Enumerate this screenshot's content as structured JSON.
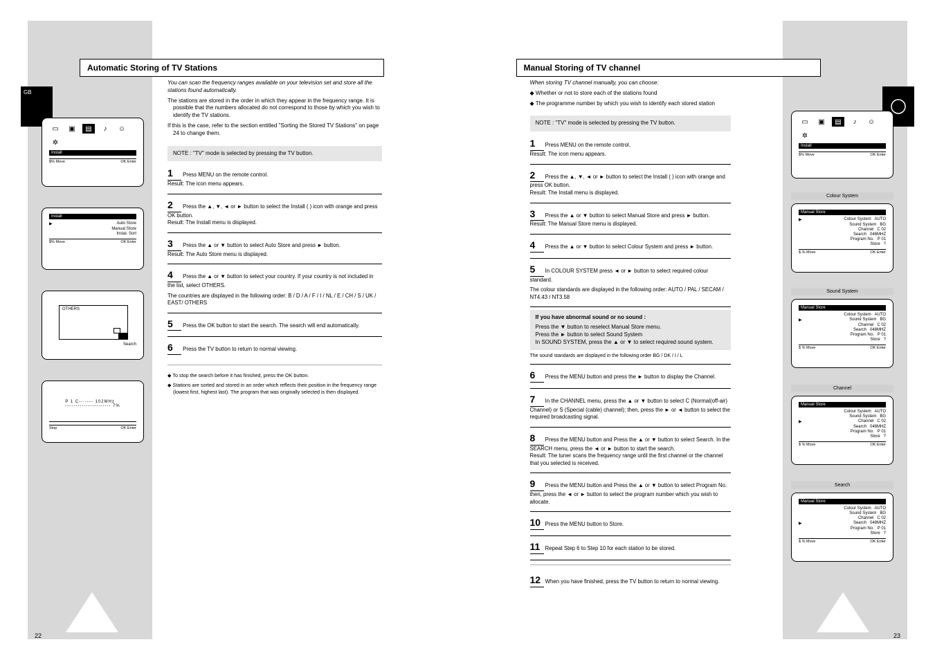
{
  "page_left": {
    "number": "22",
    "tab_letter": "GB",
    "title": "Automatic Storing of TV Stations",
    "intro": [
      "You can scan the frequency ranges available on your television set and store all the stations found automatically.",
      "The stations are stored in the order in which they appear in the frequency range. It is possible that the numbers allocated do not correspond to those by which you wish to identify the TV stations.",
      "If this is the case, refer to the section entitled \"Sorting the Stored TV Stations\" on page 24 to change them."
    ],
    "step_head": "NOTE : \"TV\" mode is selected by pressing the TV button.",
    "steps": {
      "s1": {
        "n": "1",
        "txt": "Press MENU on the remote control.",
        "res": "Result: The icon menu appears."
      },
      "s2": {
        "n": "2",
        "txt": "Press the ▲, ▼, ◄ or ► button to select the Install (  ) icon with orange and press OK button.",
        "res": "Result: The Install menu is displayed."
      },
      "s3": {
        "n": "3",
        "txt": "Press the ▲ or ▼ button to select Auto Store and press ► button.",
        "res": "Result: The Auto Store menu is displayed."
      },
      "s4": {
        "n": "4",
        "txt": "Press the ▲ or ▼ button to select your country. If your country is not included in the list, select OTHERS.",
        "res": "The countries are displayed in the following order: B / D / A / F / I / NL / E / CH / S / UK / EAST/ OTHERS"
      },
      "s5": {
        "n": "5",
        "txt": "Press the OK button to start the search. The search will end automatically.",
        "res": ""
      },
      "s6": {
        "n": "6",
        "txt": "Press the TV button to return to normal viewing.",
        "res": ""
      }
    },
    "notes": [
      "◆ To stop the search before it has finished, press the OK button.",
      "◆ Stations are sorted and stored in an order which reflects their position in the frequency range (lowest first, highest last). The program that was originally selected is then displayed."
    ],
    "screens": {
      "s1": {
        "iconbar": "Install",
        "foot_l": "$% Move",
        "foot_r": "OK Enter"
      },
      "s2": {
        "title": "Install",
        "items": [
          [
            "Auto Store",
            ""
          ],
          [
            "Manual Store",
            ""
          ],
          [
            "Instal. Sort",
            ""
          ]
        ],
        "foot_l": "$% Move",
        "foot_r": "OK Enter"
      },
      "s3": {
        "panel_label": "OTHERS",
        "btn": "Search"
      },
      "s4": {
        "line1": "P 1    C-- ----   102MHz",
        "line2": "----------------------  7%",
        "btn": "Stop",
        "foot_r": "OK Enter"
      }
    }
  },
  "page_right": {
    "number": "23",
    "tab_icon": "install-icon",
    "title": "Manual Storing of TV channel",
    "intro": [
      "When storing TV channel manually, you can choose:",
      "◆ Whether or not to store each of the stations found",
      "◆ The programme number by which you wish to identify each stored station"
    ],
    "step_head": "NOTE : \"TV\" mode is selected by pressing the TV button.",
    "steps": {
      "s1": {
        "n": "1",
        "txt": "Press MENU on the remote control.",
        "res": "Result: The icon menu appears."
      },
      "s2": {
        "n": "2",
        "txt": "Press the ▲, ▼, ◄ or ► button to select the Install (  ) icon with orange and press OK button.",
        "res": "Result: The Install menu is displayed."
      },
      "s3": {
        "n": "3",
        "txt": "Press the ▲ or ▼ button to select Manual Store and press ► button.",
        "res": "Result: The Manual Store menu is displayed."
      },
      "s4": {
        "n": "4",
        "txt": "Press the ▲ or ▼ button to select Colour System and press ► button.",
        "res": ""
      },
      "s5": {
        "n": "5",
        "txt": "In COLOUR SYSTEM press ◄ or ► button to select required colour standard.",
        "res": "The colour standards are displayed in the following order: AUTO / PAL / SECAM / NT4.43 / NT3.58"
      },
      "nested_head": "If you have abnormal sound or no sound :",
      "nested": [
        "Press the ▼ button to reselect Manual Store menu.",
        "Press the ► button to select Sound System",
        "In SOUND SYSTEM, press the ▲ or ▼ to select required sound system."
      ],
      "nested_note": "The sound standards are displayed in the following order  BG / DK / I / L",
      "s6": {
        "n": "6",
        "txt": "Press the MENU button and press the ► button to display the Channel.",
        "res": ""
      },
      "s7": {
        "n": "7",
        "txt": "In the CHANNEL menu, press the ▲ or ▼ button to select C (Normal(off-air) Channel) or S (Special (cable) channel); then, press the ► or ◄ button to select the required broadcasting signal.",
        "res": ""
      },
      "s8": {
        "n": "8",
        "txt": "Press the MENU button and Press the ▲ or ▼ button to select Search. In the SEARCH menu, press the ◄ or ► button to start the search.",
        "res": "Result: The tuner scans the frequency range until the first channel or the channel that you selected is received."
      },
      "s9": {
        "n": "9",
        "txt": "Press the MENU button and Press the ▲ or ▼ button to select Program No. then, press the ◄ or ► button to select the program number which you wish to allocate.",
        "res": ""
      },
      "s10": {
        "n": "10",
        "txt": "Press the MENU button to Store.",
        "res": ""
      },
      "s11": {
        "n": "11",
        "txt": "Repeat Step 6 to Step 10 for each station to be stored.",
        "res": ""
      },
      "s12": {
        "n": "12",
        "txt": "When you have finished, press the TV button to return to normal viewing.",
        "res": ""
      }
    },
    "screens": {
      "c1": {
        "cap": "",
        "title": "Install"
      },
      "c2": {
        "cap": "Colour System",
        "title": "Manual Store",
        "items": [
          [
            "Colour System",
            "AUTO"
          ],
          [
            "Sound System",
            "BG"
          ],
          [
            "Channel",
            "C 02"
          ],
          [
            "Search",
            "048MHZ"
          ],
          [
            "Program No.",
            "P 01"
          ],
          [
            "Store",
            "?"
          ]
        ],
        "foot_l": "$ % Move",
        "foot_r": "OK Enter"
      },
      "c3": {
        "cap": "Sound System",
        "items": [
          [
            "Colour System",
            "AUTO"
          ],
          [
            "Sound System",
            "BG"
          ],
          [
            "Channel",
            "C 02"
          ],
          [
            "Search",
            "048MHZ"
          ],
          [
            "Program No.",
            "P 01"
          ],
          [
            "Store",
            "?"
          ]
        ]
      },
      "c4": {
        "cap": "Channel",
        "items": [
          [
            "Colour System",
            "AUTO"
          ],
          [
            "Sound System",
            "BG"
          ],
          [
            "Channel",
            "C 02"
          ],
          [
            "Search",
            "048MHZ"
          ],
          [
            "Program No.",
            "P 01"
          ],
          [
            "Store",
            "?"
          ]
        ]
      },
      "c5": {
        "cap": "Search",
        "items": [
          [
            "Colour System",
            "AUTO"
          ],
          [
            "Sound System",
            "BG"
          ],
          [
            "Channel",
            "C 02"
          ],
          [
            "Search",
            "048MHZ"
          ],
          [
            "Program No.",
            "P 01"
          ],
          [
            "Store",
            "?"
          ]
        ]
      }
    }
  }
}
